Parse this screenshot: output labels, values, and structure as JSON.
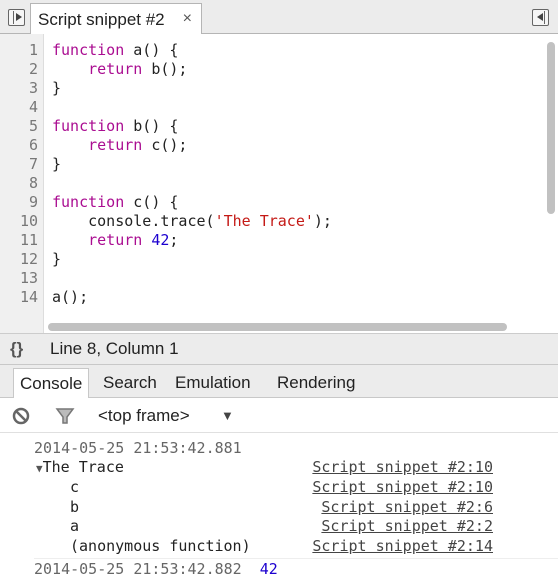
{
  "tab": {
    "title": "Script snippet #2",
    "close": "×"
  },
  "editor": {
    "lines": [
      [
        [
          "kw",
          "function"
        ],
        [
          "",
          "  a() {"
        ]
      ],
      [
        [
          "",
          "    "
        ],
        [
          "kw",
          "return"
        ],
        [
          "",
          " b();"
        ]
      ],
      [
        [
          "",
          "}"
        ]
      ],
      [],
      [
        [
          "kw",
          "function"
        ],
        [
          "",
          " b() {"
        ]
      ],
      [
        [
          "",
          "    "
        ],
        [
          "kw",
          "return"
        ],
        [
          "",
          " c();"
        ]
      ],
      [
        [
          "",
          "}"
        ]
      ],
      [],
      [
        [
          "kw",
          "function"
        ],
        [
          "",
          " c() {"
        ]
      ],
      [
        [
          "",
          "    console.trace("
        ],
        [
          "str",
          "'The Trace'"
        ],
        [
          "",
          ");"
        ]
      ],
      [
        [
          "",
          "    "
        ],
        [
          "kw",
          "return"
        ],
        [
          "num",
          " 42"
        ],
        [
          "",
          ";"
        ]
      ],
      [
        [
          "",
          "}"
        ]
      ],
      [],
      [
        [
          "",
          "a();"
        ]
      ]
    ]
  },
  "status": {
    "icon": "{}",
    "position": "Line 8, Column 1"
  },
  "drawer_tabs": [
    "Console",
    "Search",
    "Emulation",
    "Rendering"
  ],
  "toolbar": {
    "frame": "<top frame>"
  },
  "console": {
    "entry1": {
      "timestamp": "2014-05-25 21:53:42.881",
      "message": "The Trace",
      "link": "Script snippet #2:10",
      "frames": [
        {
          "fn": "c",
          "link": "Script snippet #2:10"
        },
        {
          "fn": "b",
          "link": "Script snippet #2:6"
        },
        {
          "fn": "a",
          "link": "Script snippet #2:2"
        },
        {
          "fn": "(anonymous function)",
          "link": "Script snippet #2:14"
        }
      ]
    },
    "entry2": {
      "timestamp": "2014-05-25 21:53:42.882",
      "value": "42"
    }
  },
  "colors": {
    "keyword": "#aa0d91",
    "string": "#c41a16",
    "number": "#1c00cf"
  }
}
